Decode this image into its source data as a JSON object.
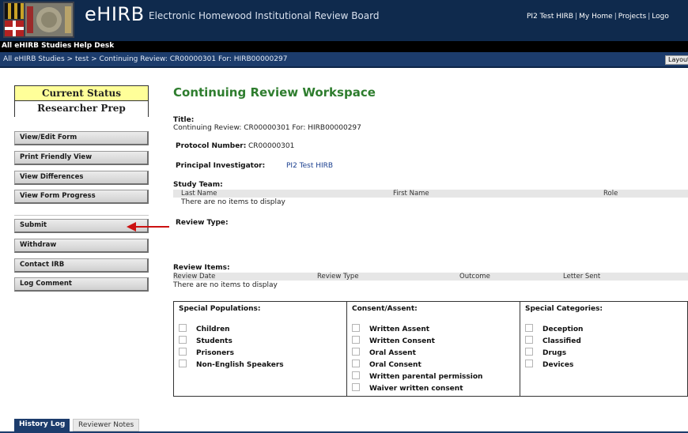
{
  "header": {
    "logo": "eHIRB",
    "subtitle": "Electronic Homewood Institutional Review Board",
    "user": "PI2 Test HIRB",
    "links": [
      "My Home",
      "Projects",
      "Logo"
    ]
  },
  "nav": {
    "items": [
      "All eHIRB Studies",
      "Help Desk"
    ]
  },
  "breadcrumb": {
    "items": [
      "All eHIRB Studies",
      "test",
      "Continuing Review: CR00000301 For: HIRB00000297"
    ],
    "separator": ">",
    "layout_button": "Layout"
  },
  "status": {
    "label": "Current Status",
    "value": "Researcher Prep"
  },
  "sidebar": {
    "buttons": [
      "View/Edit Form",
      "Print Friendly View",
      "View Differences",
      "View Form Progress"
    ],
    "actions": [
      "Submit",
      "Withdraw",
      "Contact IRB",
      "Log Comment"
    ]
  },
  "workspace": {
    "title": "Continuing Review Workspace",
    "title_label": "Title:",
    "title_value": "Continuing Review: CR00000301 For: HIRB00000297",
    "protocol_label": "Protocol Number:",
    "protocol_value": "CR00000301",
    "pi_label": "Principal Investigator:",
    "pi_value": "PI2 Test HIRB",
    "study_team_label": "Study Team:",
    "study_team_columns": [
      "Last Name",
      "First Name",
      "Role"
    ],
    "study_team_empty": "There are no items to display",
    "review_type_label": "Review Type:",
    "review_items_label": "Review Items:",
    "review_items_columns": [
      "Review Date",
      "Review Type",
      "Outcome",
      "Letter Sent"
    ],
    "review_items_empty": "There are no items to display"
  },
  "special": {
    "populations": {
      "header": "Special Populations:",
      "items": [
        "Children",
        "Students",
        "Prisoners",
        "Non-English Speakers"
      ]
    },
    "consent": {
      "header": "Consent/Assent:",
      "items": [
        "Written Assent",
        "Written Consent",
        "Oral Assent",
        "Oral Consent",
        "Written parental permission",
        "Waiver written consent"
      ]
    },
    "categories": {
      "header": "Special Categories:",
      "items": [
        "Deception",
        "Classified",
        "Drugs",
        "Devices"
      ]
    }
  },
  "tabs": [
    "History Log",
    "Reviewer Notes"
  ],
  "colors": {
    "header_bg": "#0f2a4d",
    "crumb_bg": "#1c3c6c",
    "status_highlight": "#ffff99",
    "title_green": "#2e7d2e",
    "arrow_red": "#cc1111"
  }
}
